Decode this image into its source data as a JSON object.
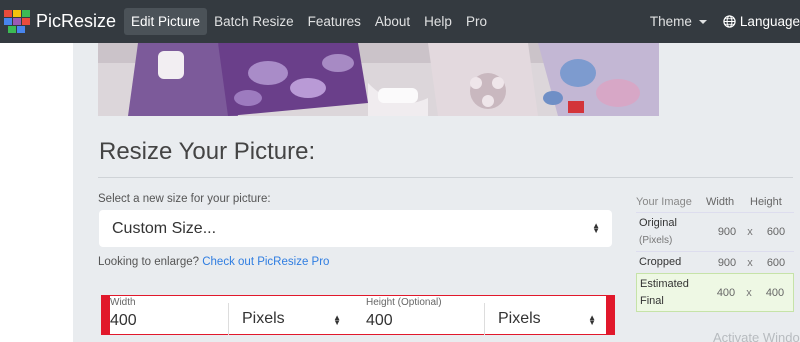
{
  "nav": {
    "brand": "PicResize",
    "items": [
      "Edit Picture",
      "Batch Resize",
      "Features",
      "About",
      "Help",
      "Pro"
    ],
    "theme": "Theme",
    "language": "Language"
  },
  "main": {
    "heading": "Resize Your Picture:",
    "select_label": "Select a new size for your picture:",
    "size_select_value": "Custom Size...",
    "enlarge_text": "Looking to enlarge?",
    "enlarge_link": "Check out PicResize Pro",
    "width_label": "Width",
    "width_value": "400",
    "width_unit": "Pixels",
    "height_label": "Height (Optional)",
    "height_value": "400",
    "height_unit": "Pixels"
  },
  "dimensions": {
    "headers": [
      "Your Image",
      "Width",
      "Height"
    ],
    "original_label": "Original",
    "original_sub": "(Pixels)",
    "original_width": "900",
    "original_height": "600",
    "cropped_label": "Cropped",
    "cropped_width": "900",
    "cropped_height": "600",
    "estimated_label": "Estimated",
    "estimated_sub": "Final",
    "estimated_width": "400",
    "estimated_height": "400",
    "separator": "x"
  },
  "overlay": {
    "watermark": "Activate Windo"
  },
  "colors": {
    "navbar": "#343a40",
    "link": "#2f7de1",
    "highlight_border": "#e1182b",
    "estimated_bg": "#eef8e4"
  }
}
